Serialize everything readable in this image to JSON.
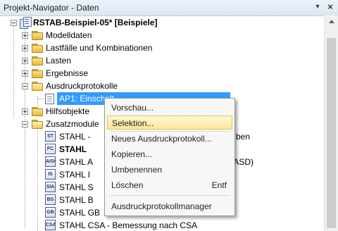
{
  "window": {
    "title": "Projekt-Navigator - Daten",
    "pin_glyph": "▾",
    "close_glyph": "×"
  },
  "tree": {
    "root": "RSTAB-Beispiel-05* [Beispiele]",
    "items": [
      {
        "label": "Modelldaten"
      },
      {
        "label": "Lastfälle und Kombinationen"
      },
      {
        "label": "Lasten"
      },
      {
        "label": "Ergebnisse"
      },
      {
        "label": "Ausdruckprotokolle"
      },
      {
        "label": "AP1: Einschalt..."
      },
      {
        "label": "Hilfsobjekte"
      },
      {
        "label": "Zusatzmodule"
      }
    ],
    "modules": [
      {
        "icon": "ST",
        "label": "STAHL -",
        "tail": "ben"
      },
      {
        "icon": "FC",
        "label": "STAHL",
        "tail": ""
      },
      {
        "icon": "AISC",
        "label": "STAHL A",
        "tail": "er ASD)"
      },
      {
        "icon": "IS",
        "label": "STAHL I",
        "tail": ""
      },
      {
        "icon": "SIA",
        "label": "STAHL S",
        "tail": ""
      },
      {
        "icon": "BS",
        "label": "STAHL B",
        "tail": ""
      },
      {
        "icon": "GB",
        "label": "STAHL GB",
        "tail": ""
      },
      {
        "icon": "CSA",
        "label": "STAHL CSA - Bemessung nach CSA",
        "tail": ""
      }
    ]
  },
  "context_menu": {
    "items": [
      {
        "label": "Vorschau...",
        "shortcut": ""
      },
      {
        "label": "Selektion...",
        "shortcut": ""
      },
      {
        "label": "Neues Ausdruckprotokoll...",
        "shortcut": ""
      },
      {
        "label": "Kopieren...",
        "shortcut": ""
      },
      {
        "label": "Umbenennen",
        "shortcut": ""
      },
      {
        "label": "Löschen",
        "shortcut": "Entf"
      },
      {
        "label": "Ausdruckprotokollmanager",
        "shortcut": ""
      }
    ],
    "highlighted_index": 1
  },
  "colors": {
    "selection": "#3399ff",
    "menu_highlight": "#fde69a",
    "folder": "#e8b93f"
  }
}
